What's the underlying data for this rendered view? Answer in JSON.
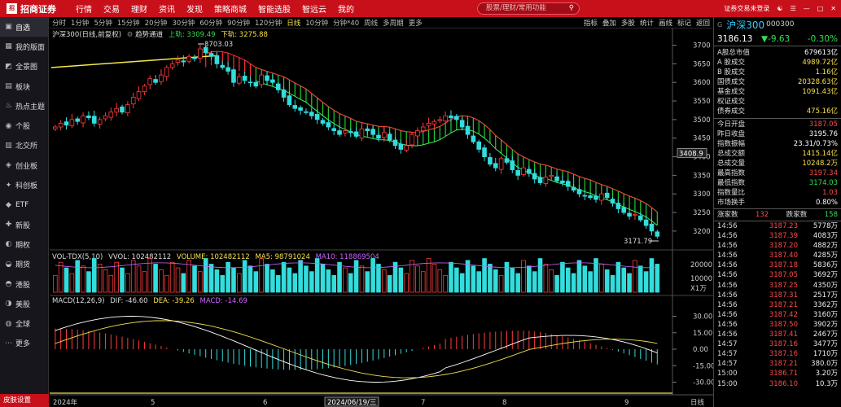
{
  "app": {
    "logo": "招商证券",
    "logo_badge": "招商"
  },
  "top_menu": [
    "行情",
    "交易",
    "理财",
    "资讯",
    "发现",
    "策略商城",
    "智能选股",
    "智远云",
    "我的"
  ],
  "search": {
    "placeholder": "股票/理财/常用功能"
  },
  "top_right": {
    "login": "证券交易未登录",
    "icons": [
      "skin-icon",
      "menu-icon",
      "minimize-icon",
      "maximize-icon",
      "close-icon"
    ]
  },
  "sidebar": {
    "items": [
      {
        "label": "自选",
        "icon": "monitor-icon"
      },
      {
        "label": "我的版面",
        "icon": "layout-icon"
      },
      {
        "label": "全景图",
        "icon": "panorama-icon"
      },
      {
        "label": "板块",
        "icon": "blocks-icon"
      },
      {
        "label": "热点主题",
        "icon": "fire-icon"
      },
      {
        "label": "个股",
        "icon": "stock-icon"
      },
      {
        "label": "北交所",
        "icon": "bse-icon"
      },
      {
        "label": "创业板",
        "icon": "growth-icon"
      },
      {
        "label": "科创板",
        "icon": "star-icon"
      },
      {
        "label": "ETF",
        "icon": "etf-icon"
      },
      {
        "label": "新股",
        "icon": "ipo-icon"
      },
      {
        "label": "期权",
        "icon": "option-icon"
      },
      {
        "label": "期货",
        "icon": "futures-icon"
      },
      {
        "label": "港股",
        "icon": "hk-icon"
      },
      {
        "label": "美股",
        "icon": "us-icon"
      },
      {
        "label": "全球",
        "icon": "globe-icon"
      },
      {
        "label": "更多",
        "icon": "more-icon"
      }
    ],
    "bottom": "皮肤设置"
  },
  "timeframes": [
    "分时",
    "1分钟",
    "5分钟",
    "15分钟",
    "20分钟",
    "30分钟",
    "60分钟",
    "90分钟",
    "120分钟",
    "日线",
    "10分钟",
    "分钟*40",
    "周线",
    "多周期",
    "更多"
  ],
  "selected_timeframe": "日线",
  "chart_tools": [
    "指标",
    "叠加",
    "多股",
    "统计",
    "画线",
    "标记",
    "返回"
  ],
  "kline_header": {
    "name": "沪深300(日线,前复权)",
    "indicator": "趋势通道",
    "upper": "上轨: 3309.49",
    "lower": "下轨: 3275.88"
  },
  "vol_header": {
    "name": "VOL-TDX(5,10)",
    "vvol": "VVOL: 102482112",
    "volume": "VOLUME: 102482112",
    "ma5": "MA5: 98791024",
    "ma10": "MA10: 118869504"
  },
  "macd_header": {
    "name": "MACD(12,26,9)",
    "dif": "DIF: -46.60",
    "dea": "DEA: -39.26",
    "macd": "MACD: -14.69"
  },
  "annotations": {
    "high": "3703.03",
    "low": "3171.79",
    "cursor_price": "3408.9",
    "date_tag": "2024/06/19/三"
  },
  "x_axis": {
    "labels": [
      "2024年",
      "5",
      "6",
      "7",
      "8",
      "9"
    ],
    "period": "日线"
  },
  "price_axis": [
    "3700",
    "3650",
    "3600",
    "3550",
    "3500",
    "3450",
    "3400",
    "3350",
    "3300",
    "3250",
    "3200"
  ],
  "vol_axis": [
    "20000",
    "10000",
    "X1万"
  ],
  "macd_axis": [
    "30.00",
    "15.00",
    "0.00",
    "-15.00",
    "-30.00"
  ],
  "colors": {
    "up": "#ff3c3c",
    "down": "#33dddd",
    "accent": "#c8101a",
    "channel_up": "#ff3030",
    "channel_down": "#22cc33",
    "trend": "#f5e74e"
  },
  "quote": {
    "badge": "G",
    "name": "沪深300",
    "code": "000300",
    "price": "3186.13",
    "change": "▼-9.63",
    "change_pct": "-0.30%",
    "rows1": [
      {
        "k": "A股总市值",
        "v": "679613亿",
        "c": "#ffffff"
      },
      {
        "k": "A 股成交",
        "v": "4989.72亿",
        "c": "#f4e04d"
      },
      {
        "k": "B 股成交",
        "v": "1.16亿",
        "c": "#f4e04d"
      },
      {
        "k": "国债成交",
        "v": "20328.63亿",
        "c": "#f4e04d"
      },
      {
        "k": "基金成交",
        "v": "1091.43亿",
        "c": "#f4e04d"
      },
      {
        "k": "权证成交",
        "v": "",
        "c": "#f4e04d"
      },
      {
        "k": "债券成交",
        "v": "475.16亿",
        "c": "#f4e04d"
      }
    ],
    "rows2": [
      {
        "k": "今日开盘",
        "v": "3187.05",
        "c": "#ff4a4a"
      },
      {
        "k": "昨日收盘",
        "v": "3195.76",
        "c": "#ffffff"
      },
      {
        "k": "指数振幅",
        "v": "23.31/0.73%",
        "c": "#ffffff"
      },
      {
        "k": "总成交额",
        "v": "1415.14亿",
        "c": "#f4e04d"
      },
      {
        "k": "总成交量",
        "v": "10248.2万",
        "c": "#f4e04d"
      },
      {
        "k": "最高指数",
        "v": "3197.34",
        "c": "#ff4a4a"
      },
      {
        "k": "最低指数",
        "v": "3174.03",
        "c": "#33dd55"
      },
      {
        "k": "指数量比",
        "v": "1.03",
        "c": "#ff4a4a"
      },
      {
        "k": "市场换手",
        "v": "0.80%",
        "c": "#ffffff"
      }
    ],
    "updown": {
      "up_label": "涨家数",
      "up": "132",
      "down_label": "跌家数",
      "down": "158"
    },
    "ticks": [
      {
        "t": "14:56",
        "p": "3187.23",
        "v": "5778万"
      },
      {
        "t": "14:56",
        "p": "3187.39",
        "v": "4083万"
      },
      {
        "t": "14:56",
        "p": "3187.20",
        "v": "4882万"
      },
      {
        "t": "14:56",
        "p": "3187.40",
        "v": "4285万"
      },
      {
        "t": "14:56",
        "p": "3187.18",
        "v": "5836万"
      },
      {
        "t": "14:56",
        "p": "3187.05",
        "v": "3692万"
      },
      {
        "t": "14:56",
        "p": "3187.25",
        "v": "4350万"
      },
      {
        "t": "14:56",
        "p": "3187.31",
        "v": "2517万"
      },
      {
        "t": "14:56",
        "p": "3187.21",
        "v": "3362万"
      },
      {
        "t": "14:56",
        "p": "3187.42",
        "v": "3160万"
      },
      {
        "t": "14:56",
        "p": "3187.50",
        "v": "3902万"
      },
      {
        "t": "14:56",
        "p": "3187.41",
        "v": "2467万"
      },
      {
        "t": "14:57",
        "p": "3187.16",
        "v": "3477万"
      },
      {
        "t": "14:57",
        "p": "3187.16",
        "v": "1710万"
      },
      {
        "t": "14:57",
        "p": "3187.21",
        "v": "380.0万"
      },
      {
        "t": "15:00",
        "p": "3186.71",
        "v": "3.20万"
      },
      {
        "t": "15:00",
        "p": "3186.10",
        "v": "10.3万"
      }
    ]
  },
  "chart_data": {
    "type": "candlestick",
    "title": "沪深300(日线,前复权)",
    "ylim": [
      3180,
      3710
    ],
    "closes": [
      3480,
      3490,
      3485,
      3500,
      3495,
      3510,
      3505,
      3490,
      3500,
      3510,
      3520,
      3530,
      3520,
      3540,
      3560,
      3575,
      3590,
      3610,
      3600,
      3620,
      3640,
      3650,
      3660,
      3655,
      3670,
      3665,
      3690,
      3680,
      3670,
      3650,
      3640,
      3630,
      3600,
      3615,
      3605,
      3600,
      3590,
      3620,
      3605,
      3600,
      3580,
      3560,
      3540,
      3530,
      3525,
      3520,
      3510,
      3500,
      3490,
      3480,
      3470,
      3460,
      3470,
      3465,
      3455,
      3475,
      3470,
      3460,
      3450,
      3465,
      3445,
      3430,
      3420,
      3430,
      3460,
      3470,
      3480,
      3490,
      3495,
      3500,
      3510,
      3505,
      3500,
      3480,
      3460,
      3440,
      3420,
      3400,
      3380,
      3370,
      3395,
      3385,
      3365,
      3350,
      3370,
      3355,
      3340,
      3330,
      3345,
      3350,
      3335,
      3330,
      3320,
      3310,
      3300,
      3295,
      3290,
      3285,
      3300,
      3290,
      3275,
      3260,
      3250,
      3240,
      3245,
      3230,
      3215,
      3200,
      3186
    ]
  }
}
